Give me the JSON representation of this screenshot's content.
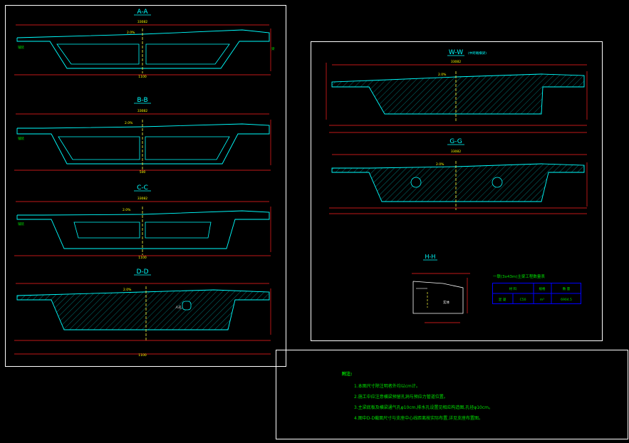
{
  "colors": {
    "background": "#000000",
    "frame": "#ffffff",
    "outline": "#00ffff",
    "dimension": "#ff2020",
    "text_green": "#00e000",
    "text_yellow": "#ffff00",
    "centerline": "#ffff40",
    "table_border": "#0000ff",
    "label_magenta": "#ff00ff"
  },
  "sections": [
    {
      "title": "A-A",
      "width_top": "33082",
      "slope": "2.0%",
      "kind": "box"
    },
    {
      "title": "B-B",
      "width_top": "33082",
      "slope": "2.0%",
      "kind": "box"
    },
    {
      "title": "C-C",
      "width_top": "33082",
      "slope": "2.0%",
      "kind": "box"
    },
    {
      "title": "D-D",
      "width_top": "33082",
      "slope": "2.0%",
      "kind": "solid"
    }
  ],
  "right_sections": [
    {
      "title": "W-W",
      "subtitle": "(中跨端横梁)",
      "width_top": "33082",
      "slope": "2.0%"
    },
    {
      "title": "G-G",
      "width_top": "33082",
      "slope": "2.0%"
    }
  ],
  "detail": {
    "title": "H-H",
    "label": "实体"
  },
  "quantity_table": {
    "title": "一联(3x43m)主梁工程数量表",
    "headers": [
      "材 料",
      "规格",
      "数 量"
    ],
    "row": [
      "混 凝",
      "C50",
      "m³",
      "6904.5"
    ]
  },
  "notes": {
    "heading": "附注:",
    "items": [
      "1.本图尺寸除注明者外均以cm计。",
      "2.施工中应注意横梁预留孔洞与预应力管道位置。",
      "3.主梁底板及横梁通气孔φ10cm,排水孔设置见相应构造图,孔径φ10cm。",
      "4.图中D-D截面尺寸与支座中心线距离按实际布置,详见支座布置图。"
    ]
  },
  "labels": {
    "center_line": "道路中心线",
    "dim_left": "300",
    "dim_a": "150",
    "dim_b": "500",
    "dim_center": "1100",
    "dim_side": "375",
    "dim_right": "300",
    "deck_label": "铺装",
    "hole_label": "人孔",
    "height_label": "梁高"
  }
}
